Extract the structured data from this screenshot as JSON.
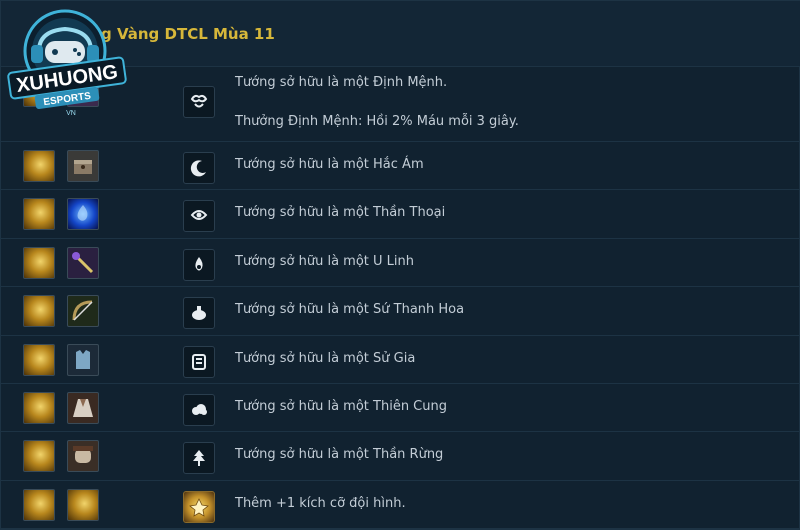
{
  "header": {
    "title": "g Vàng DTCL Mùa 11",
    "logo_text_main": "XUHUONG",
    "logo_text_sub": "ESPORTS",
    "logo_text_tag": "VN"
  },
  "rows": [
    {
      "desc": "Tướng sở hữu là một Định Mệnh.",
      "desc2": "Thưởng Định Mệnh: Hồi 2% Máu mỗi 3 giây.",
      "trait_icon": "fate-trait-icon",
      "component_icon": "hidden-component-icon"
    },
    {
      "desc": "Tướng sở hữu là một Hắc Ám",
      "trait_icon": "moon-trait-icon",
      "component_icon": "chest-component-icon"
    },
    {
      "desc": "Tướng sở hữu là một Thần Thoại",
      "trait_icon": "mythic-trait-icon",
      "component_icon": "tear-component-icon"
    },
    {
      "desc": "Tướng sở hữu là một U Linh",
      "trait_icon": "ghost-trait-icon",
      "component_icon": "rod-component-icon"
    },
    {
      "desc": "Tướng sở hữu là một Sứ Thanh Hoa",
      "trait_icon": "porcelain-trait-icon",
      "component_icon": "bow-component-icon"
    },
    {
      "desc": "Tướng sở hữu là một Sử Gia",
      "trait_icon": "scroll-trait-icon",
      "component_icon": "vest-component-icon"
    },
    {
      "desc": "Tướng sở hữu là một Thiên Cung",
      "trait_icon": "cloud-trait-icon",
      "component_icon": "cloak-component-icon"
    },
    {
      "desc": "Tướng sở hữu là một Thần Rừng",
      "trait_icon": "forest-trait-icon",
      "component_icon": "glove-component-icon"
    },
    {
      "desc": "Thêm +1 kích cỡ đội hình.",
      "trait_icon": "golden-spatula-trait-icon",
      "component_icon": "spatula-component-icon"
    }
  ],
  "colors": {
    "background": "#112230",
    "title": "#d6b73a",
    "text": "#c3cdd6"
  }
}
